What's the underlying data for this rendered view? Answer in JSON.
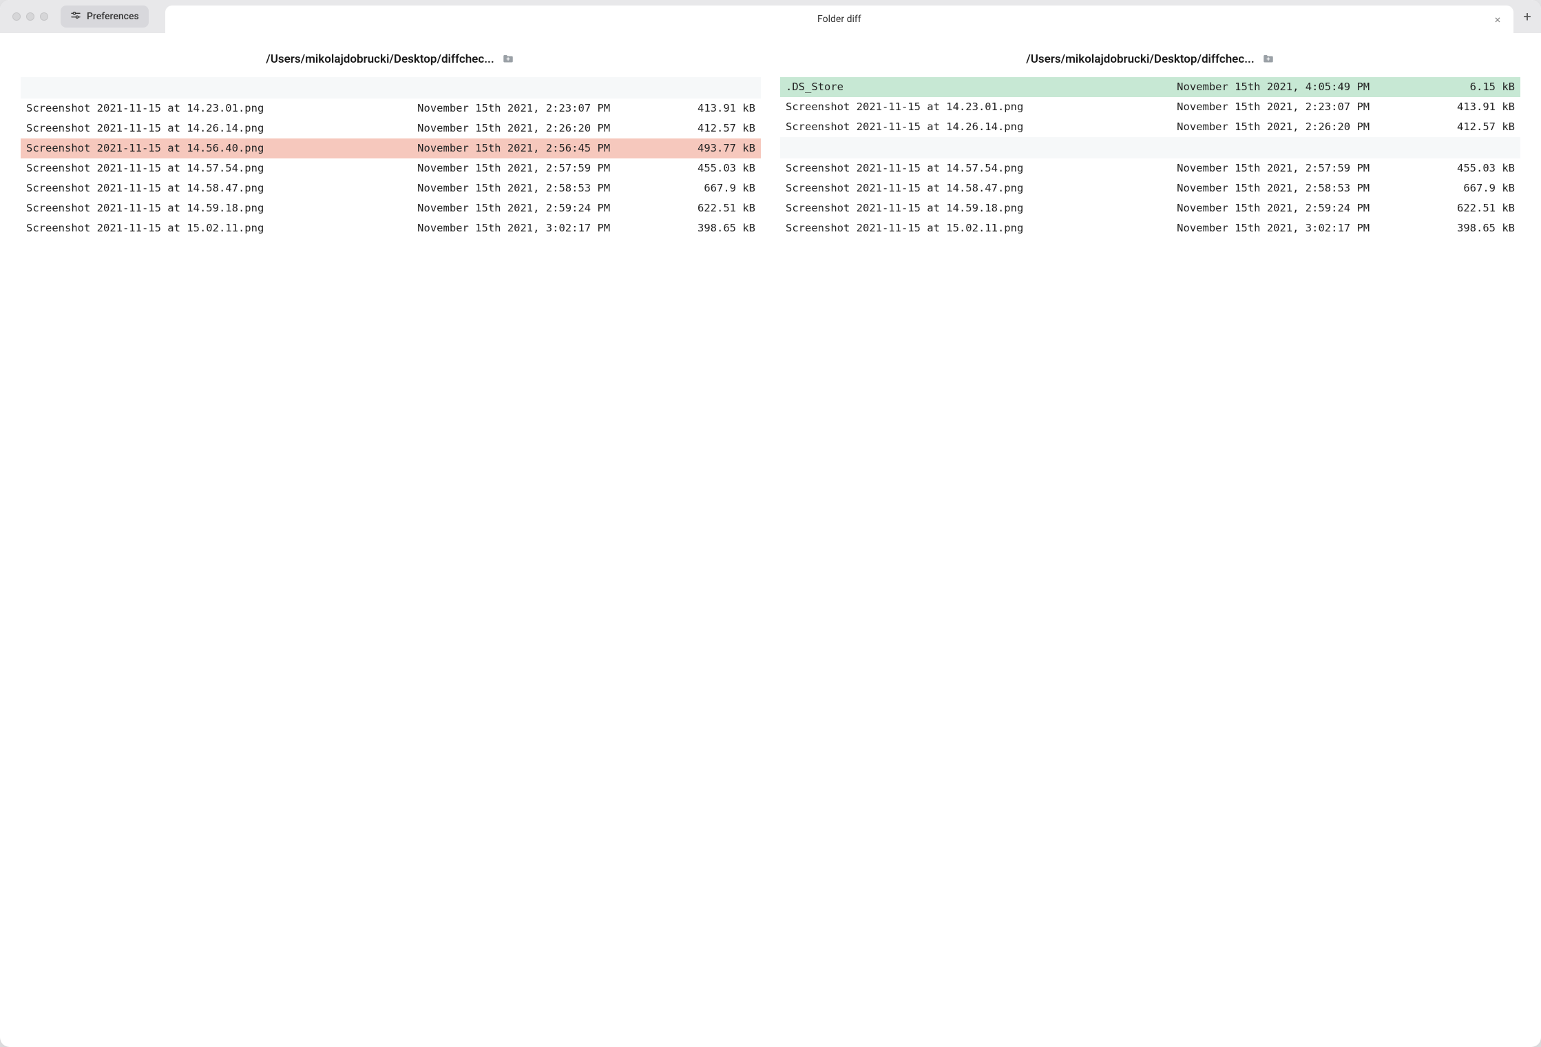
{
  "titlebar": {
    "preferences_label": "Preferences",
    "tab_title": "Folder diff",
    "close_glyph": "×",
    "new_tab_glyph": "+"
  },
  "paths": {
    "left": "/Users/mikolajdobrucki/Desktop/diffchec...",
    "right": "/Users/mikolajdobrucki/Desktop/diffchec..."
  },
  "left_rows": [
    {
      "type": "spacer"
    },
    {
      "type": "same",
      "name": "Screenshot 2021-11-15 at 14.23.01.png",
      "date": "November 15th 2021, 2:23:07 PM",
      "size": "413.91 kB"
    },
    {
      "type": "same",
      "name": "Screenshot 2021-11-15 at 14.26.14.png",
      "date": "November 15th 2021, 2:26:20 PM",
      "size": "412.57 kB"
    },
    {
      "type": "removed",
      "name": "Screenshot 2021-11-15 at 14.56.40.png",
      "date": "November 15th 2021, 2:56:45 PM",
      "size": "493.77 kB"
    },
    {
      "type": "same",
      "name": "Screenshot 2021-11-15 at 14.57.54.png",
      "date": "November 15th 2021, 2:57:59 PM",
      "size": "455.03 kB"
    },
    {
      "type": "same",
      "name": "Screenshot 2021-11-15 at 14.58.47.png",
      "date": "November 15th 2021, 2:58:53 PM",
      "size": "667.9 kB"
    },
    {
      "type": "same",
      "name": "Screenshot 2021-11-15 at 14.59.18.png",
      "date": "November 15th 2021, 2:59:24 PM",
      "size": "622.51 kB"
    },
    {
      "type": "same",
      "name": "Screenshot 2021-11-15 at 15.02.11.png",
      "date": "November 15th 2021, 3:02:17 PM",
      "size": "398.65 kB"
    }
  ],
  "right_rows": [
    {
      "type": "added",
      "name": ".DS_Store",
      "date": "November 15th 2021, 4:05:49 PM",
      "size": "6.15 kB"
    },
    {
      "type": "same",
      "name": "Screenshot 2021-11-15 at 14.23.01.png",
      "date": "November 15th 2021, 2:23:07 PM",
      "size": "413.91 kB"
    },
    {
      "type": "same",
      "name": "Screenshot 2021-11-15 at 14.26.14.png",
      "date": "November 15th 2021, 2:26:20 PM",
      "size": "412.57 kB"
    },
    {
      "type": "spacer"
    },
    {
      "type": "same",
      "name": "Screenshot 2021-11-15 at 14.57.54.png",
      "date": "November 15th 2021, 2:57:59 PM",
      "size": "455.03 kB"
    },
    {
      "type": "same",
      "name": "Screenshot 2021-11-15 at 14.58.47.png",
      "date": "November 15th 2021, 2:58:53 PM",
      "size": "667.9 kB"
    },
    {
      "type": "same",
      "name": "Screenshot 2021-11-15 at 14.59.18.png",
      "date": "November 15th 2021, 2:59:24 PM",
      "size": "622.51 kB"
    },
    {
      "type": "same",
      "name": "Screenshot 2021-11-15 at 15.02.11.png",
      "date": "November 15th 2021, 3:02:17 PM",
      "size": "398.65 kB"
    }
  ]
}
